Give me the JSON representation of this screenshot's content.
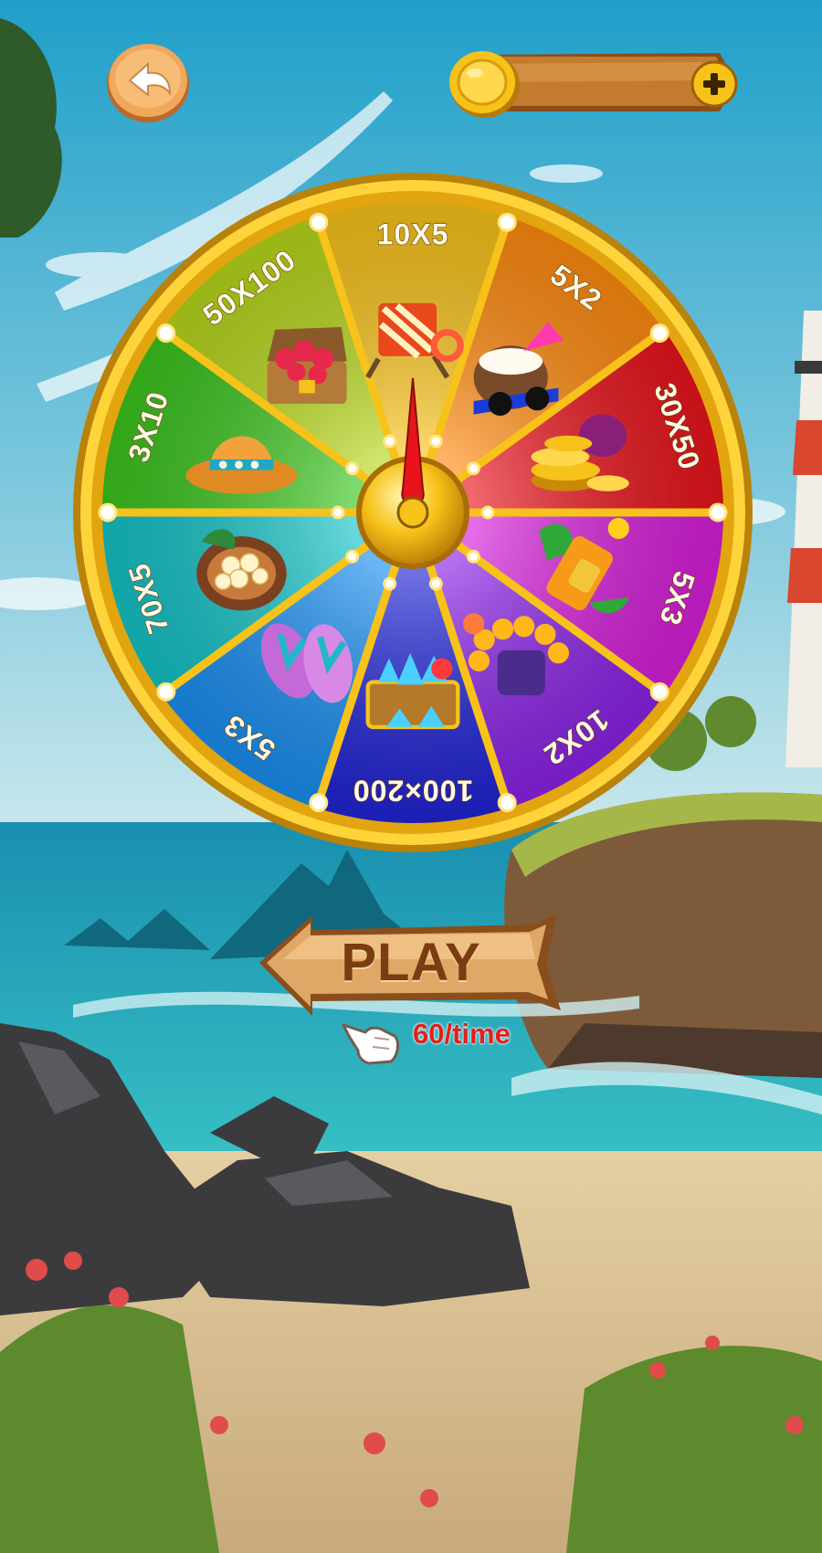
{
  "header": {
    "back_icon": "back-arrow-icon",
    "coins": {
      "icon": "gold-coin-icon",
      "balance": "",
      "add_icon": "plus-icon"
    }
  },
  "wheel": {
    "pointer_icon": "needle-pointer-icon",
    "segments": [
      {
        "label": "10X5",
        "color": "#f7c21a",
        "icon": "beach-chair-icon"
      },
      {
        "label": "5X2",
        "color": "#ff8a10",
        "icon": "coconut-drink-icon"
      },
      {
        "label": "30X50",
        "color": "#e8141c",
        "icon": "gold-coins-pile-icon"
      },
      {
        "label": "5X3",
        "color": "#d61ed9",
        "icon": "sunscreen-bottle-icon"
      },
      {
        "label": "10X2",
        "color": "#8a22e6",
        "icon": "flower-lei-icon"
      },
      {
        "label": "100×200",
        "color": "#2024d4",
        "icon": "diamond-chest-icon"
      },
      {
        "label": "5X3",
        "color": "#1a8ef0",
        "icon": "flip-flops-icon"
      },
      {
        "label": "70X5",
        "color": "#14c2c6",
        "icon": "pearl-shell-icon"
      },
      {
        "label": "3X10",
        "color": "#3cc41e",
        "icon": "straw-hat-icon"
      },
      {
        "label": "50X100",
        "color": "#b6d61a",
        "icon": "treasure-chest-icon"
      }
    ]
  },
  "play": {
    "label": "PLAY",
    "cost": "60/time",
    "hand_icon": "pointing-hand-icon"
  },
  "colors": {
    "sky_top": "#1f9fc9",
    "sea": "#1fa7b6",
    "sand": "#dbc59c",
    "gold": "#f3c318",
    "wood": "#c98a44",
    "cost_text": "#e0201c"
  }
}
